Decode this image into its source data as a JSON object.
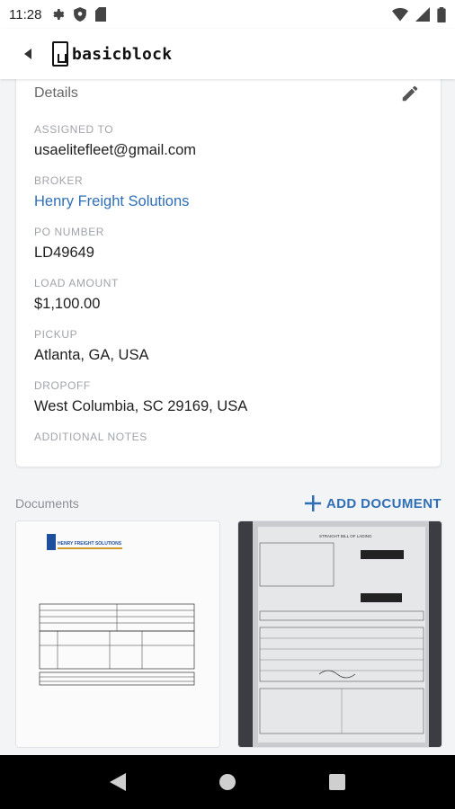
{
  "status_bar": {
    "time": "11:28"
  },
  "app_bar": {
    "logo_text": "basicblock"
  },
  "details": {
    "title": "Details",
    "fields": [
      {
        "label": "ASSIGNED TO",
        "value": "usaelitefleet@gmail.com"
      },
      {
        "label": "BROKER",
        "value": "Henry Freight Solutions"
      },
      {
        "label": "PO NUMBER",
        "value": "LD49649"
      },
      {
        "label": "LOAD AMOUNT",
        "value": "$1,100.00"
      },
      {
        "label": "PICKUP",
        "value": "Atlanta, GA, USA"
      },
      {
        "label": "DROPOFF",
        "value": "West Columbia, SC 29169, USA"
      },
      {
        "label": "ADDITIONAL NOTES",
        "value": ""
      }
    ]
  },
  "documents": {
    "label": "Documents",
    "add_label": "ADD DOCUMENT",
    "items": [
      {
        "header_text": "HENRY FREIGHT SOLUTIONS"
      },
      {
        "header_text": "STRAIGHT BILL OF LADING"
      }
    ]
  },
  "colors": {
    "accent": "#2f6fb7",
    "label_gray": "#a0a4aa",
    "background": "#f3f4f6"
  },
  "icons": [
    "settings-icon",
    "shield-icon",
    "sim-icon",
    "wifi-icon",
    "signal-icon",
    "battery-icon",
    "back-arrow-icon",
    "edit-pencil-icon",
    "plus-icon",
    "nav-back-icon",
    "nav-home-icon",
    "nav-recents-icon"
  ]
}
